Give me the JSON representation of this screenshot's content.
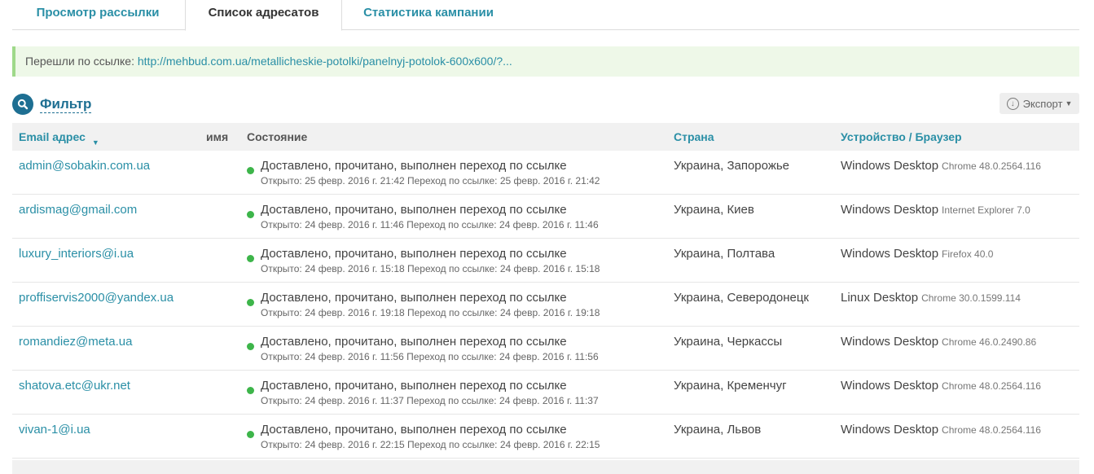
{
  "tabs": {
    "preview": "Просмотр рассылки",
    "recipients": "Список адресатов",
    "stats": "Статистика кампании"
  },
  "notice": {
    "prefix": "Перешли по ссылке:",
    "link": "http://mehbud.com.ua/metallicheskie-potolki/panelnyj-potolok-600x600/?..."
  },
  "filter": {
    "label": "Фильтр"
  },
  "export": {
    "label": "Экспорт"
  },
  "table": {
    "headers": {
      "email": "Email адрес",
      "name": "имя",
      "status": "Состояние",
      "country": "Страна",
      "device": "Устройство / Браузер"
    },
    "status_color": "#3db54a",
    "rows": [
      {
        "email": "admin@sobakin.com.ua",
        "status": "Доставлено, прочитано, выполнен переход по ссылке",
        "detail": "Открыто: 25 февр. 2016 г. 21:42 Переход по ссылке: 25 февр. 2016 г. 21:42",
        "country": "Украина, Запорожье",
        "device": "Windows Desktop",
        "browser": "Chrome 48.0.2564.116"
      },
      {
        "email": "ardismag@gmail.com",
        "status": "Доставлено, прочитано, выполнен переход по ссылке",
        "detail": "Открыто: 24 февр. 2016 г. 11:46 Переход по ссылке: 24 февр. 2016 г. 11:46",
        "country": "Украина, Киев",
        "device": "Windows Desktop",
        "browser": "Internet Explorer 7.0"
      },
      {
        "email": "luxury_interiors@i.ua",
        "status": "Доставлено, прочитано, выполнен переход по ссылке",
        "detail": "Открыто: 24 февр. 2016 г. 15:18 Переход по ссылке: 24 февр. 2016 г. 15:18",
        "country": "Украина, Полтава",
        "device": "Windows Desktop",
        "browser": "Firefox 40.0"
      },
      {
        "email": "proffiservis2000@yandex.ua",
        "status": "Доставлено, прочитано, выполнен переход по ссылке",
        "detail": "Открыто: 24 февр. 2016 г. 19:18 Переход по ссылке: 24 февр. 2016 г. 19:18",
        "country": "Украина, Северодонецк",
        "device": "Linux Desktop",
        "browser": "Chrome 30.0.1599.114"
      },
      {
        "email": "romandiez@meta.ua",
        "status": "Доставлено, прочитано, выполнен переход по ссылке",
        "detail": "Открыто: 24 февр. 2016 г. 11:56 Переход по ссылке: 24 февр. 2016 г. 11:56",
        "country": "Украина, Черкассы",
        "device": "Windows Desktop",
        "browser": "Chrome 46.0.2490.86"
      },
      {
        "email": "shatova.etc@ukr.net",
        "status": "Доставлено, прочитано, выполнен переход по ссылке",
        "detail": "Открыто: 24 февр. 2016 г. 11:37 Переход по ссылке: 24 февр. 2016 г. 11:37",
        "country": "Украина, Кременчуг",
        "device": "Windows Desktop",
        "browser": "Chrome 48.0.2564.116"
      },
      {
        "email": "vivan-1@i.ua",
        "status": "Доставлено, прочитано, выполнен переход по ссылке",
        "detail": "Открыто: 24 февр. 2016 г. 22:15 Переход по ссылке: 24 февр. 2016 г. 22:15",
        "country": "Украина, Львов",
        "device": "Windows Desktop",
        "browser": "Chrome 48.0.2564.116"
      }
    ]
  }
}
